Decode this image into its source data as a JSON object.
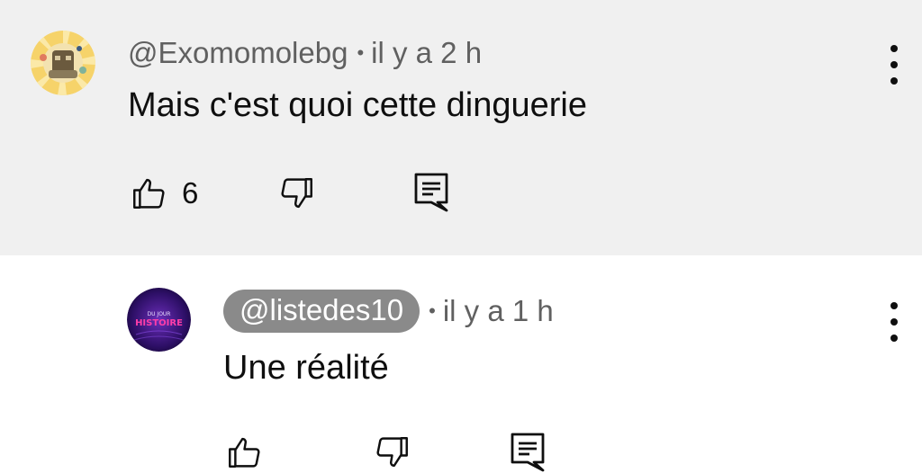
{
  "comments": [
    {
      "handle": "@Exomomolebg",
      "separator": "•",
      "time": "il y a 2 h",
      "text": "Mais c'est quoi cette dinguerie",
      "likes": "6",
      "avatar_icon": "sunburst-avatar-icon",
      "handle_highlighted": false
    },
    {
      "handle": "@listedes10",
      "separator": "•",
      "time": "il y a 1 h",
      "text": "Une réalité",
      "likes": "",
      "avatar_icon": "purple-channel-avatar-icon",
      "avatar_caption": "HISTOIRE",
      "handle_highlighted": true
    }
  ],
  "icons": {
    "like": "thumb-up-icon",
    "dislike": "thumb-down-icon",
    "reply": "reply-comment-icon",
    "menu": "more-vertical-icon"
  },
  "colors": {
    "top_background": "#f0f0f0",
    "pill_background": "#8a8a8a",
    "text": "#0f0f0f",
    "meta": "#606060"
  }
}
